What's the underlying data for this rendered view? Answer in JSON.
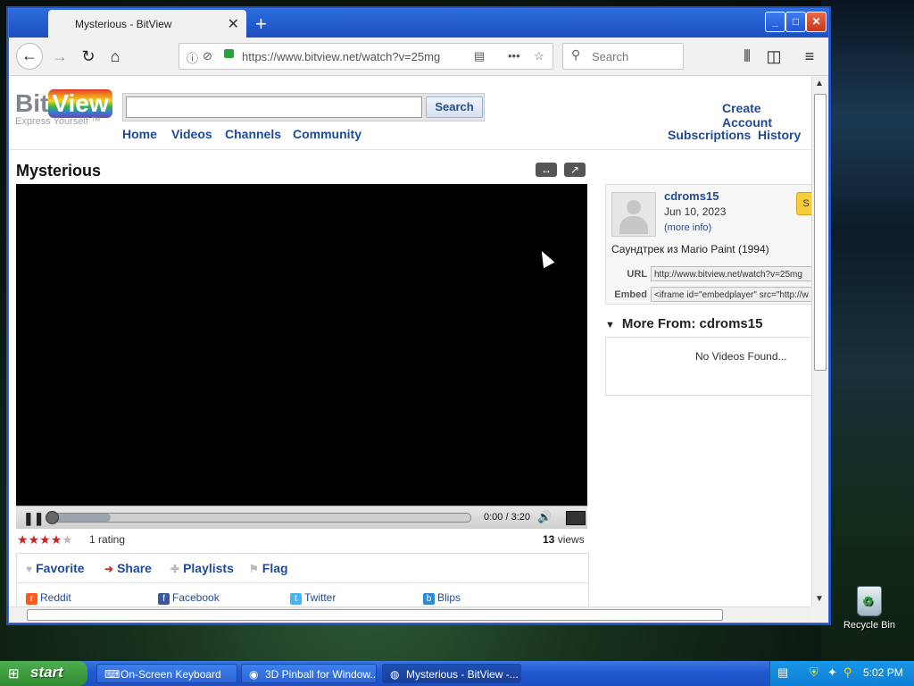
{
  "browser": {
    "tab_title": "Mysterious - BitView",
    "url": "https://www.bitview.net/watch?v=25mg",
    "search_placeholder": "Search",
    "new_tab": "+",
    "tab_close": "✕"
  },
  "site": {
    "logo_bit": "Bit",
    "logo_view": "View",
    "tagline": "Express Yourself ™",
    "search_button": "Search",
    "nav": [
      "Home",
      "Videos",
      "Channels",
      "Community"
    ],
    "create_account": "Create Account",
    "subscriptions": "Subscriptions",
    "history": "History"
  },
  "video": {
    "title": "Mysterious",
    "time": "0:00 / 3:20",
    "progress": 0.15,
    "rating_stars": 4,
    "rating_text": "1 rating",
    "views_count": "13",
    "views_label": "views"
  },
  "actions": {
    "favorite": "Favorite",
    "share": "Share",
    "playlists": "Playlists",
    "flag": "Flag"
  },
  "share_targets": [
    "Reddit",
    "Facebook",
    "Twitter",
    "Blips"
  ],
  "uploader": {
    "name": "cdroms15",
    "date": "Jun 10, 2023",
    "more_info": "(more info)",
    "subscribe_partial": "S",
    "description": "Саундтрек из Mario Paint (1994)",
    "url_label": "URL",
    "url_value": "http://www.bitview.net/watch?v=25mg",
    "embed_label": "Embed",
    "embed_value": "<iframe id=\"embedplayer\" src=\"http://w"
  },
  "more_from": {
    "title": "More From: cdroms15",
    "empty": "No Videos Found..."
  },
  "desktop": {
    "recycle_bin": "Recycle Bin"
  },
  "taskbar": {
    "start": "start",
    "items": [
      "On-Screen Keyboard",
      "3D Pinball for Window...",
      "Mysterious - BitView -..."
    ],
    "clock": "5:02 PM"
  },
  "colors": {
    "link": "#1f4a98",
    "star": "#cc2222",
    "xp_blue": "#235bd0",
    "start_green": "#2f8c2f"
  }
}
